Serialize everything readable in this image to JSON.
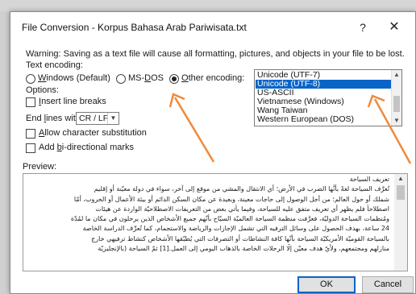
{
  "dialog": {
    "title": "File Conversion - Korpus Bahasa Arab Pariwisata.txt",
    "help_label": "?",
    "close_label": "✕"
  },
  "warning": "Warning: Saving as a text file will cause all formatting, pictures, and objects in your file to be lost.",
  "encoding": {
    "label": "Text encoding:",
    "options": [
      {
        "pre": "",
        "u": "W",
        "post": "indows (Default)",
        "checked": false
      },
      {
        "pre": "MS-",
        "u": "D",
        "post": "OS",
        "checked": false
      },
      {
        "pre": "",
        "u": "O",
        "post": "ther encoding:",
        "checked": true
      }
    ],
    "list": [
      "Unicode (UTF-7)",
      "Unicode (UTF-8)",
      "US-ASCII",
      "Vietnamese (Windows)",
      "Wang Taiwan",
      "Western European (DOS)"
    ],
    "selected_index": 1
  },
  "options": {
    "label": "Options:",
    "insert_line_breaks": {
      "u": "I",
      "rest": "nsert line breaks",
      "checked": false
    },
    "end_lines": {
      "pre": "End ",
      "u": "l",
      "post": "ines with:",
      "value": "CR / LF"
    },
    "allow_substitution": {
      "u": "A",
      "rest": "llow character substitution",
      "checked": false
    },
    "bidi_marks": {
      "pre": "Add ",
      "u": "b",
      "post": "i-directional marks",
      "checked": false
    }
  },
  "preview": {
    "label": "Preview:",
    "lines": [
      "تعريف السياحة",
      "تُعرَّف السياحة لغةً بأنَّها الضرب في الأرض؛ أي الانتقال والمشي من موقع إلى آخر، سواء في دولة معيّنة أو إقليم",
      "شملك أو حول العالم؛ من أجل الوصول إلى حاجات معينة، وبعيدة عن مكان السكن الدائم أو بيئة الأعمال أو الحروب، أمّا",
      "اصطلاحاً فلم يظهر أي تعريف متفق عليه للسياحة، وفيما يأتي بعض من التعريفات الاصطلاحيّة الواردة عن هيئات",
      "ومُنظمات السياحة الدوليّة، فعرَّفت منظمة السياحة العالميّة السيّاح بأنّهم جميع الأشخاص الذين يرحلون في مكان ما لمُدّة",
      "24 ساعة، بهدف الحصول على وسائل الترفيه التي تشمل الإجازات والرياضة والاستجمام، كما تُعرِّف الدراسة الخاصة",
      "بالسياحة القوميّة الأمريكيّة السياحة بأنّها كافة النشاطات أو التصرفات التي يُطبّقها الأشخاص كنشاط ترفيهي خارج",
      "منازلهم ومجتمعهم، ولأيّ هدف معيّن إلّا الرحلات الخاصة بالذهاب اليومي إلى العمل.[1] ثمّ السياحة (بالإنجليزيّة"
    ]
  },
  "buttons": {
    "ok": "OK",
    "cancel": "Cancel"
  },
  "colors": {
    "accent": "#0a64c8",
    "arrow": "#f08a3c"
  }
}
